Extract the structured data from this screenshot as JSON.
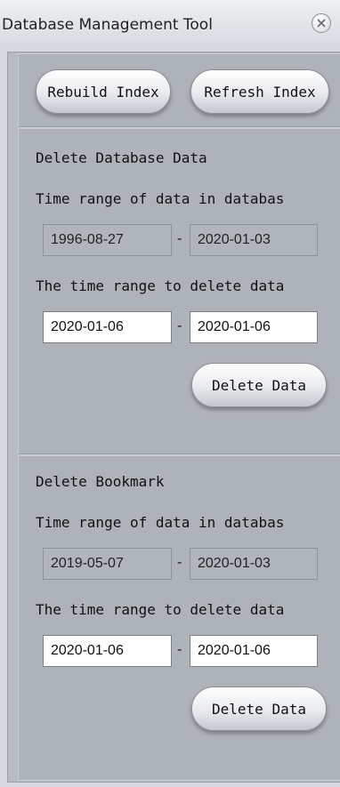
{
  "window": {
    "title": "Database Management Tool"
  },
  "toolbar": {
    "rebuild_label": "Rebuild Index",
    "refresh_label": "Refresh Index"
  },
  "db_section": {
    "heading": "Delete Database Data",
    "range_label": "Time range of data in databas",
    "range_from": "1996-08-27",
    "range_to": "2020-01-03",
    "delete_label": "The time range to delete data",
    "delete_from": "2020-01-06",
    "delete_to": "2020-01-06",
    "button": "Delete Data",
    "separator": "-"
  },
  "bookmark_section": {
    "heading": "Delete Bookmark",
    "range_label": "Time range of data in databas",
    "range_from": "2019-05-07",
    "range_to": "2020-01-03",
    "delete_label": "The time range to delete data",
    "delete_from": "2020-01-06",
    "delete_to": "2020-01-06",
    "button": "Delete Data",
    "separator": "-"
  }
}
